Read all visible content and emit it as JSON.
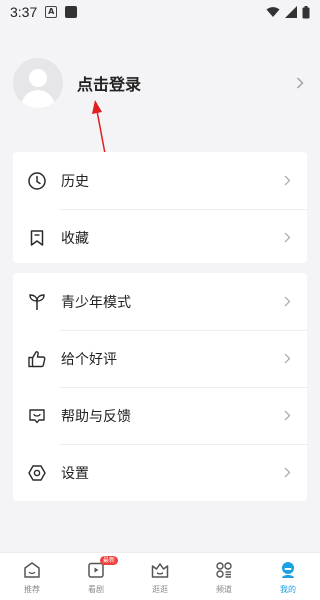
{
  "status_bar": {
    "time": "3:37",
    "a_badge": "A"
  },
  "profile": {
    "login_label": "点击登录"
  },
  "menu_group_1": [
    {
      "label": "历史",
      "icon": "clock-icon"
    },
    {
      "label": "收藏",
      "icon": "bookmark-icon"
    }
  ],
  "menu_group_2": [
    {
      "label": "青少年模式",
      "icon": "sprout-icon"
    },
    {
      "label": "给个好评",
      "icon": "thumbs-up-icon"
    },
    {
      "label": "帮助与反馈",
      "icon": "feedback-icon"
    },
    {
      "label": "设置",
      "icon": "settings-hex-icon"
    }
  ],
  "bottom_nav": {
    "badge": "最新",
    "items": [
      {
        "label": "推荐",
        "icon": "home-icon",
        "active": false
      },
      {
        "label": "看剧",
        "icon": "play-tv-icon",
        "active": false
      },
      {
        "label": "逛逛",
        "icon": "basket-icon",
        "active": false
      },
      {
        "label": "频道",
        "icon": "grid-icon",
        "active": false
      },
      {
        "label": "我的",
        "icon": "profile-icon",
        "active": true
      }
    ]
  },
  "colors": {
    "accent": "#1ba0e2",
    "annotation_arrow": "#e02020",
    "badge": "#f0413c",
    "background": "#f4f4f6"
  }
}
